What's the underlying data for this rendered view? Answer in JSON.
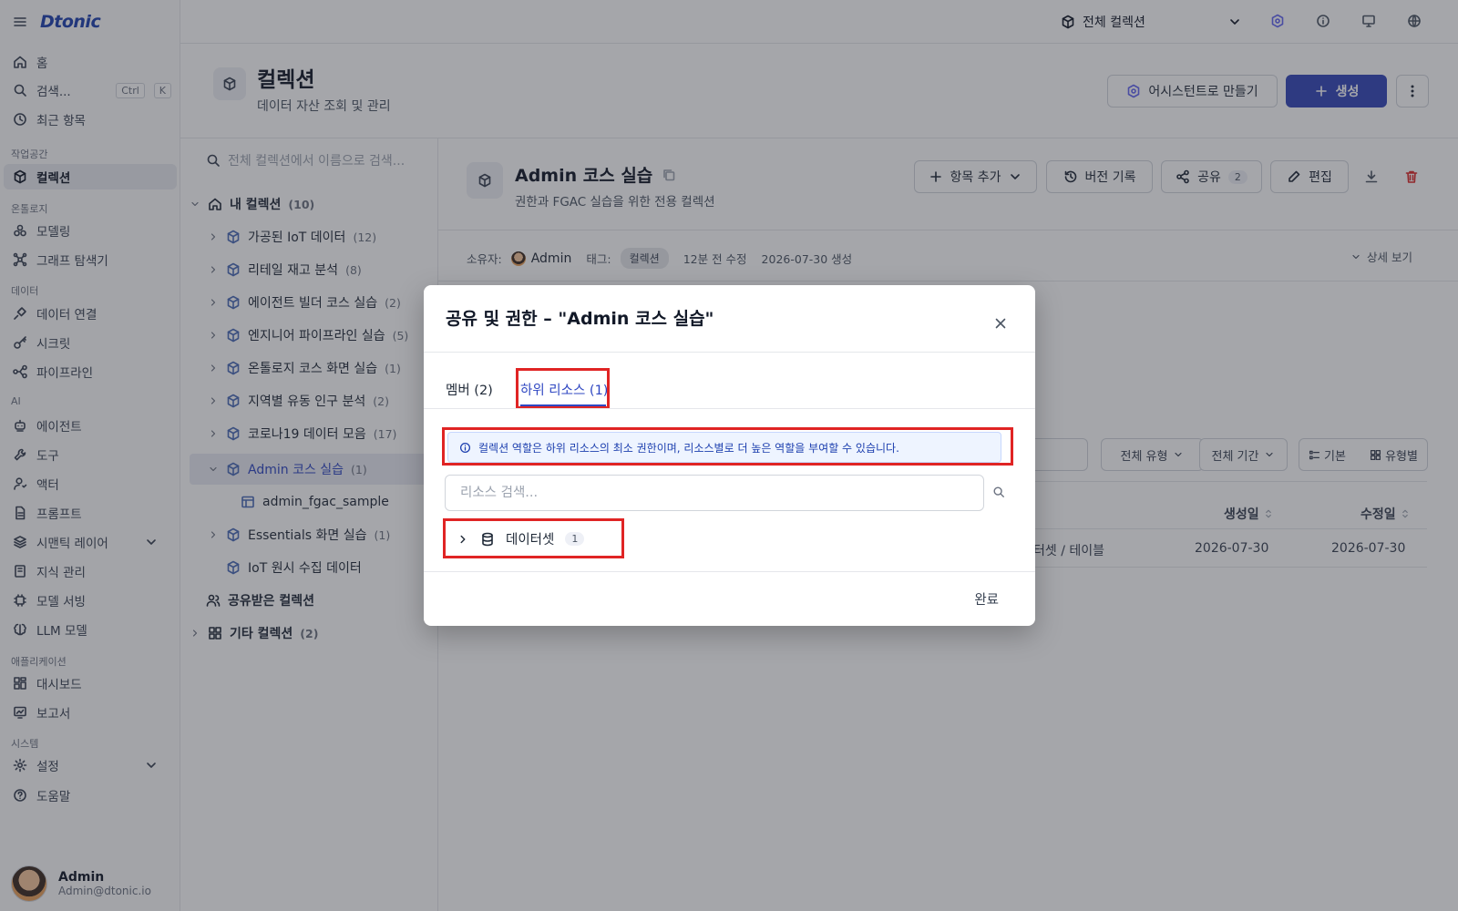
{
  "app": {
    "logo": "Dtonic"
  },
  "topbar": {
    "collection_select": "전체 컬렉션"
  },
  "sidebar": {
    "home": "홈",
    "search": "검색...",
    "kbd_ctrl": "Ctrl",
    "kbd_k": "K",
    "recent": "최근 항목",
    "section_workspace": "작업공간",
    "collections": "컬렉션",
    "section_ontology": "온톨로지",
    "modeling": "모델링",
    "graph_explorer": "그래프 탐색기",
    "section_data": "데이터",
    "data_connection": "데이터 연결",
    "secrets": "시크릿",
    "pipeline": "파이프라인",
    "section_ai": "AI",
    "agent": "에이전트",
    "tools": "도구",
    "actor": "액터",
    "prompt": "프롬프트",
    "semantic_layer": "시맨틱 레이어",
    "knowledge": "지식 관리",
    "model_serving": "모델 서빙",
    "llm_model": "LLM 모델",
    "section_applications": "애플리케이션",
    "dashboard": "대시보드",
    "report": "보고서",
    "section_system": "시스템",
    "settings": "설정",
    "help": "도움말",
    "user_name": "Admin",
    "user_email": "Admin@dtonic.io"
  },
  "page": {
    "title": "컬렉션",
    "subtitle": "데이터 자산 조회 및 관리",
    "assistant_button": "어시스턴트로 만들기",
    "create_button": "생성"
  },
  "tree": {
    "search_placeholder": "전체 컬렉션에서 이름으로 검색...",
    "my_collections": "내 컬렉션",
    "my_collections_count": "(10)",
    "items": [
      {
        "label": "가공된 IoT 데이터",
        "count": "(12)"
      },
      {
        "label": "리테일 재고 분석",
        "count": "(8)"
      },
      {
        "label": "에이전트 빌더 코스 실습",
        "count": "(2)"
      },
      {
        "label": "엔지니어 파이프라인 실습",
        "count": "(5)"
      },
      {
        "label": "온톨로지 코스 화면 실습",
        "count": "(1)"
      },
      {
        "label": "지역별 유동 인구 분석",
        "count": "(2)"
      },
      {
        "label": "코로나19 데이터 모음",
        "count": "(17)"
      },
      {
        "label": "Admin 코스 실습",
        "count": "(1)"
      },
      {
        "label": "admin_fgac_sample",
        "count": ""
      },
      {
        "label": "Essentials 화면 실습",
        "count": "(1)"
      },
      {
        "label": "IoT 원시 수집 데이터",
        "count": ""
      }
    ],
    "shared_collections": "공유받은 컬렉션",
    "other_collections": "기타 컬렉션",
    "other_collections_count": "(2)"
  },
  "detail": {
    "title": "Admin 코스 실습",
    "subtitle": "권한과 FGAC 실습을 위한 전용 컬렉션",
    "add_item": "항목 추가",
    "version_history": "버전 기록",
    "share": "공유",
    "share_count": "2",
    "edit": "편집",
    "owner_label": "소유자:",
    "owner": "Admin",
    "tag_label": "태그:",
    "tag": "컬렉션",
    "modified": "12분 전 수정",
    "created": "2026-07-30 생성",
    "view_details": "상세 보기",
    "filter_type": "전체 유형",
    "filter_period": "전체 기간",
    "view_basic": "기본",
    "view_by_type": "유형별",
    "col_created": "생성일",
    "col_modified": "수정일",
    "row_type": "터셋 / 테이블",
    "row_created": "2026-07-30",
    "row_modified": "2026-07-30"
  },
  "modal": {
    "title": "공유 및 권한 – \"Admin 코스 실습\"",
    "tab_members": "멤버 (2)",
    "tab_subresources": "하위 리소스 (1)",
    "info": "컬렉션 역할은 하위 리소스의 최소 권한이며, 리소스별로 더 높은 역할을 부여할 수 있습니다.",
    "search_placeholder": "리소스 검색...",
    "resource_label": "데이터셋",
    "resource_count": "1",
    "done": "완료"
  },
  "colors": {
    "primary": "#3346b8",
    "active_tab": "#2f47c2",
    "highlight": "#e02424",
    "delete": "#dc2626"
  }
}
